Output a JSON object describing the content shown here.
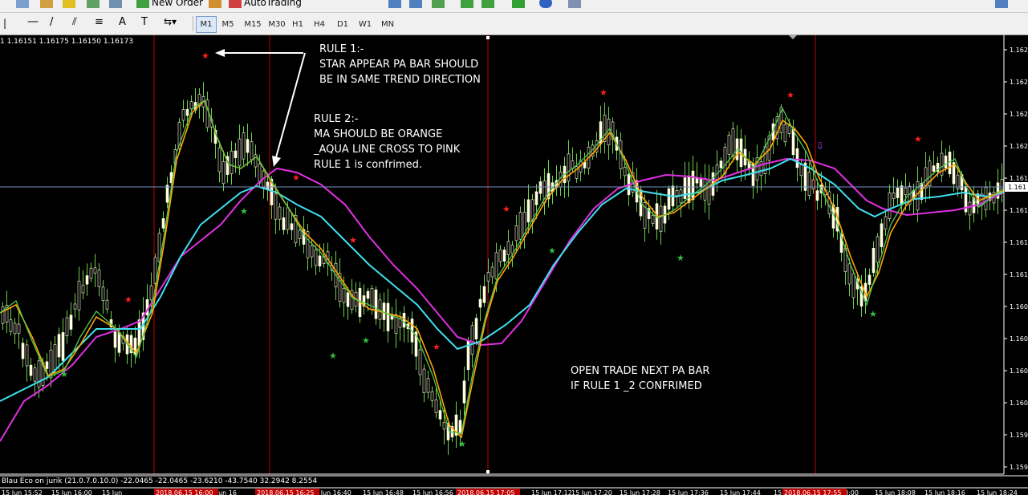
{
  "toolbar1": {
    "new_order_label": "New Order",
    "autotrading_label": "AutoTrading"
  },
  "timeframes": [
    "M1",
    "M5",
    "M15",
    "M30",
    "H1",
    "H4",
    "D1",
    "W1",
    "MN"
  ],
  "active_timeframe": "M1",
  "ohlc_text": "1  1.16151 1.16175 1.16150 1.16173",
  "indicator_text": "Blau Eco on jurik (21.0.7.0.10.0) -22.0465 -22.0465 -23.6210 -43.7540 32.2942 8.2554",
  "notes": {
    "rule1": "RULE 1:-\nSTAR APPEAR PA BAR SHOULD\nBE IN SAME TREND DIRECTION",
    "rule2": "RULE 2:-\nMA SHOULD BE ORANGE\n_AQUA LINE CROSS TO PINK\nRULE 1 is confrimed.",
    "open_trade": "OPEN TRADE NEXT PA BAR\nIF RULE 1 _2 CONFRIMED"
  },
  "price_axis": {
    "labels": [
      "1.162",
      "1.162",
      "1.162",
      "1.162",
      "1.161",
      "1.161",
      "1.161",
      "1.161",
      "1.160",
      "1.160",
      "1.160",
      "1.160",
      "1.159",
      "1.159"
    ],
    "current_price": "1.161"
  },
  "time_axis": {
    "labels": [
      "15 Jun 15:52",
      "15 Jun 16:00",
      "15 Jun",
      "16",
      "15 Jun 16",
      "15 Jun 16:40",
      "15 Jun 16:48",
      "15 Jun 16:56",
      "15 Jun 17:12",
      "15 Jun 17:20",
      "15 Jun 17:28",
      "15 Jun 17:36",
      "15 Jun 17:44",
      "15 J",
      "8:00",
      "15 Jun 18:08",
      "15 Jun 18:16",
      "15 Jun 18:24"
    ],
    "highlighted": [
      "2018.06.15 16:00",
      "2018.06.15 16:25",
      "2018.06.15 17:05",
      "2018.06.15 17:55"
    ]
  },
  "colors": {
    "candle": "#ffffe0",
    "wick": "#6cd24a",
    "ma_orange": "#ffa500",
    "ma_aqua": "#40e0f0",
    "ma_pink": "#e030e0",
    "ma_green": "#50c850",
    "star_red": "#ff2020",
    "star_green": "#30c040",
    "vline": "#c00000"
  },
  "chart_data": {
    "type": "candlestick",
    "title": "",
    "series": [
      {
        "name": "",
        "values": []
      }
    ]
  }
}
